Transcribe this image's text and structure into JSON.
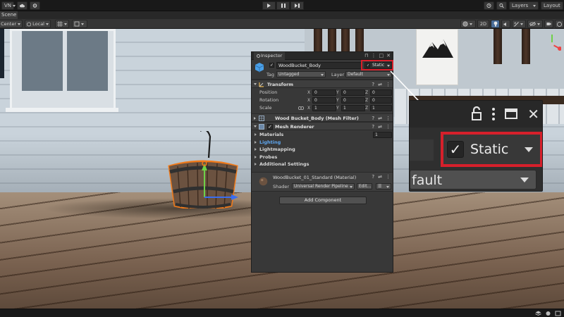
{
  "toolbar": {
    "account_label": "VN",
    "layers_label": "Layers",
    "layout_label": "Layout"
  },
  "scene": {
    "tab_label": "Scene",
    "pivot_label": "Center",
    "space_label": "Local",
    "mode_2d": "2D"
  },
  "inspector": {
    "tab_title": "Inspector",
    "object_name": "WoodBucket_Body",
    "static_label": "Static",
    "tag_label": "Tag",
    "tag_value": "Untagged",
    "layer_label": "Layer",
    "layer_value": "Default",
    "transform": {
      "title": "Transform",
      "rows": [
        {
          "label": "Position",
          "x": "0",
          "y": "0",
          "z": "0"
        },
        {
          "label": "Rotation",
          "x": "0",
          "y": "0",
          "z": "0"
        },
        {
          "label": "Scale",
          "x": "1",
          "y": "1",
          "z": "1"
        }
      ]
    },
    "mesh_filter_title": "Wood Bucket_Body (Mesh Filter)",
    "mesh_renderer": {
      "title": "Mesh Renderer",
      "materials_label": "Materials",
      "materials_count": "1",
      "lighting_label": "Lighting",
      "lightmapping_label": "Lightmapping",
      "probes_label": "Probes",
      "additional_label": "Additional Settings"
    },
    "material": {
      "name": "WoodBucket_01_Standard (Material)",
      "shader_label": "Shader",
      "shader_value": "Universal Render Pipeline",
      "edit_label": "Edit..."
    },
    "add_component_label": "Add Component"
  },
  "zoom": {
    "static_label": "Static",
    "layer_partial": "fault"
  },
  "colors": {
    "highlight": "#d6202b",
    "link_blue": "#5fa7f0",
    "selection_orange": "#f07a1a"
  }
}
